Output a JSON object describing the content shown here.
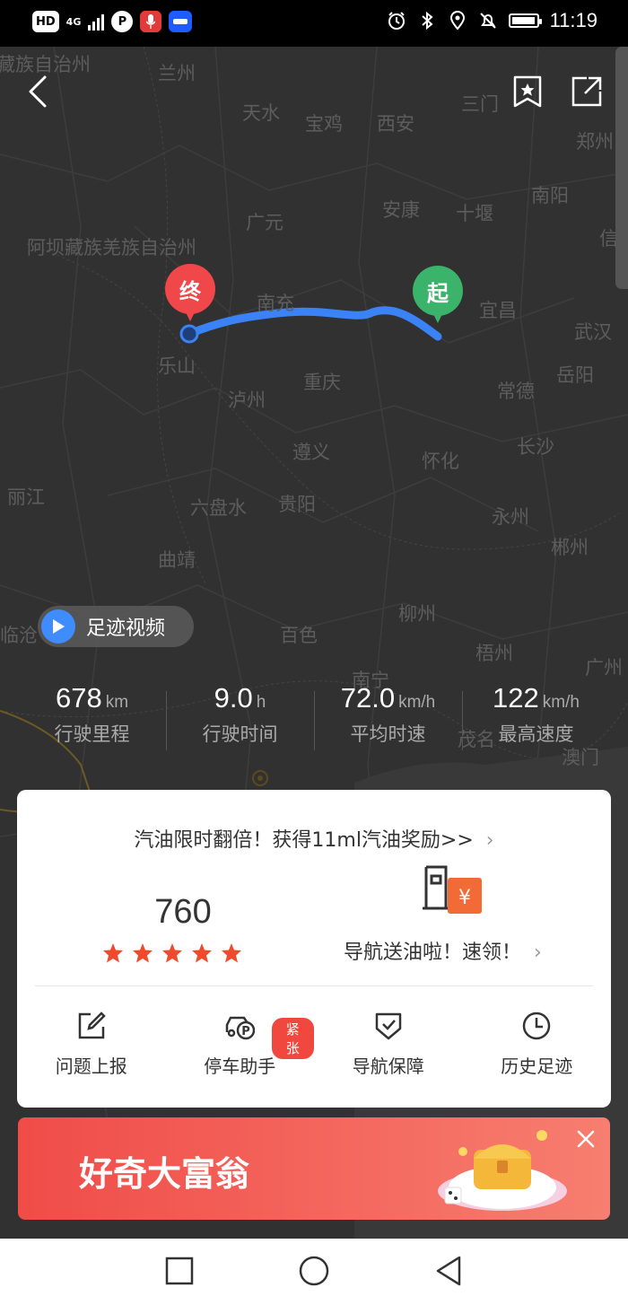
{
  "status_bar": {
    "badges": [
      "HD",
      "4G",
      "P"
    ],
    "time": "11:19",
    "icons": [
      "alarm-icon",
      "bluetooth-icon",
      "location-icon",
      "mute-icon",
      "battery-icon"
    ]
  },
  "map": {
    "places": [
      "藏族自治州",
      "兰州",
      "天水",
      "宝鸡",
      "西安",
      "三门",
      "郑州",
      "南阳",
      "广元",
      "安康",
      "十堰",
      "信",
      "阿坝藏族羌族自治州",
      "南充",
      "宜昌",
      "武汉",
      "乐山",
      "重庆",
      "常德",
      "岳阳",
      "泸州",
      "遵义",
      "怀化",
      "长沙",
      "丽江",
      "六盘水",
      "贵阳",
      "永州",
      "曲靖",
      "郴州",
      "柳州",
      "临沧",
      "百色",
      "梧州",
      "广州",
      "南宁",
      "茂名",
      "澳门"
    ],
    "start_marker": "起",
    "end_marker": "终"
  },
  "top_actions": {
    "back_icon": "back-arrow-icon",
    "bookmark_icon": "bookmark-star-icon",
    "share_icon": "share-export-icon"
  },
  "video_button": {
    "label": "足迹视频"
  },
  "stats": [
    {
      "value": "678",
      "unit": "km",
      "label": "行驶里程"
    },
    {
      "value": "9.0",
      "unit": "h",
      "label": "行驶时间"
    },
    {
      "value": "72.0",
      "unit": "km/h",
      "label": "平均时速"
    },
    {
      "value": "122",
      "unit": "km/h",
      "label": "最高速度"
    }
  ],
  "card": {
    "promo_text": "汽油限时翻倍！获得11ml汽油奖励>>",
    "promo_chevron": "›",
    "score": "760",
    "stars": 5,
    "fuel_text": "导航送油啦！速领！",
    "fuel_chevron": "›",
    "fuel_currency": "¥",
    "tools": [
      {
        "label": "问题上报",
        "icon": "edit-report-icon"
      },
      {
        "label": "停车助手",
        "icon": "parking-car-icon",
        "tag": "紧张"
      },
      {
        "label": "导航保障",
        "icon": "shield-check-icon"
      },
      {
        "label": "历史足迹",
        "icon": "clock-history-icon"
      }
    ]
  },
  "banner": {
    "title": "好奇大富翁"
  },
  "colors": {
    "route": "#3b82f6",
    "start_marker": "#3bb36a",
    "end_marker": "#f0474a",
    "accent": "#f0483e"
  }
}
